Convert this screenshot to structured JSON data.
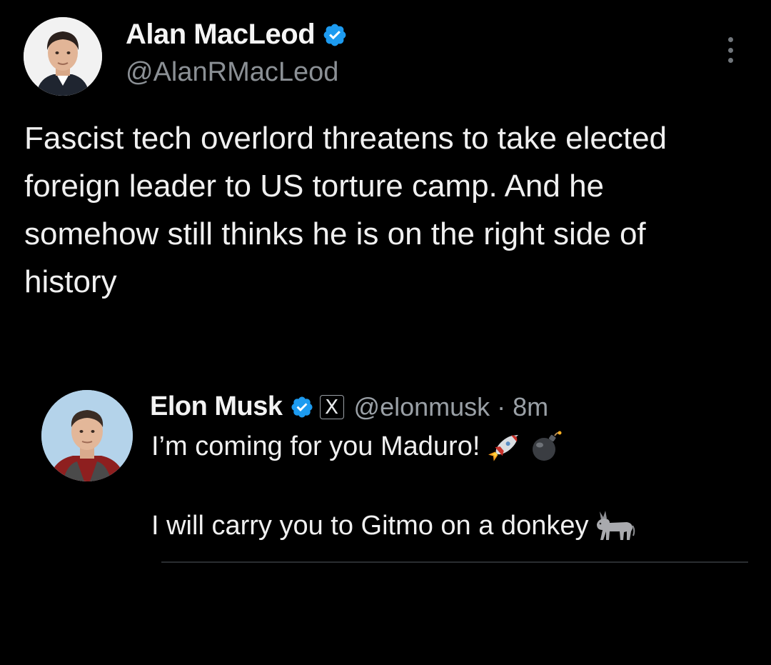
{
  "tweet": {
    "author_name": "Alan MacLeod",
    "handle": "@AlanRMacLeod",
    "text": "Fascist tech overlord threatens to take elected foreign leader to US torture camp. And he somehow still thinks he is on the right side of history",
    "verified_color": "#1d9bf0"
  },
  "quoted": {
    "author_name": "Elon Musk",
    "x_badge": "X",
    "handle": "@elonmusk",
    "separator": " · ",
    "time": "8m",
    "line1": "I’m coming for you Maduro!",
    "line2": "I will carry you to Gitmo on a donkey",
    "line1_emojis": [
      "rocket-icon",
      "bomb-icon"
    ],
    "line2_emojis": [
      "donkey-icon"
    ]
  },
  "icons": {
    "verified": "verified-badge-icon",
    "more": "more-options-icon"
  },
  "colors": {
    "background": "#000000",
    "primary_text": "#e7e9ea",
    "secondary_text": "#8b9095"
  }
}
